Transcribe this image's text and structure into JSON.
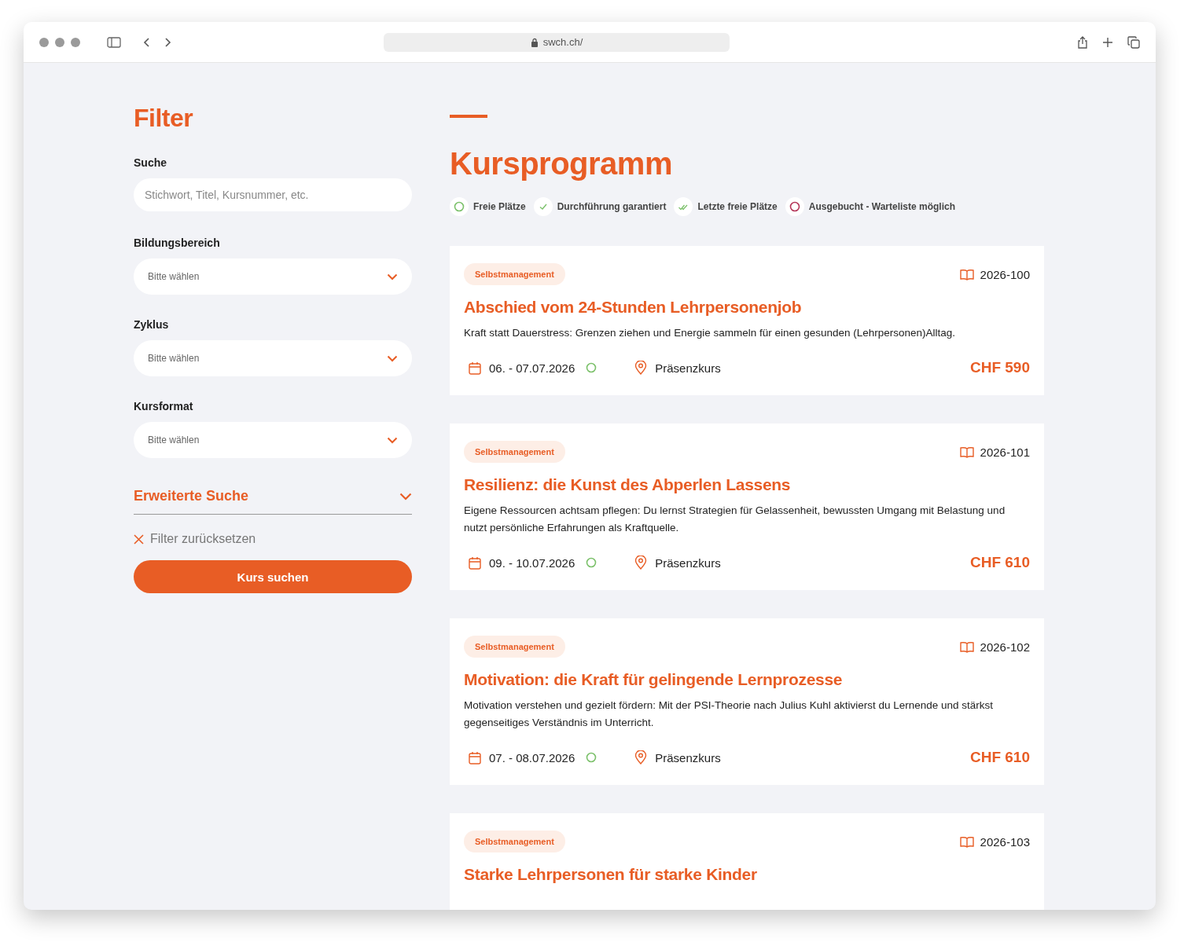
{
  "browser": {
    "url": "swch.ch/"
  },
  "filter": {
    "title": "Filter",
    "search": {
      "label": "Suche",
      "placeholder": "Stichwort, Titel, Kursnummer, etc."
    },
    "selects": [
      {
        "label": "Bildungsbereich",
        "placeholder": "Bitte wählen"
      },
      {
        "label": "Zyklus",
        "placeholder": "Bitte wählen"
      },
      {
        "label": "Kursformat",
        "placeholder": "Bitte wählen"
      }
    ],
    "advanced": {
      "label": "Erweiterte Suche",
      "expanded": false
    },
    "reset": "Filter zurücksetzen",
    "submit": "Kurs suchen"
  },
  "main": {
    "title": "Kursprogramm",
    "legend": [
      {
        "kind": "free",
        "label": "Freie Plätze"
      },
      {
        "kind": "guaranteed",
        "label": "Durchführung garantiert"
      },
      {
        "kind": "last",
        "label": "Letzte freie Plätze"
      },
      {
        "kind": "booked",
        "label": "Ausgebucht - Warteliste möglich"
      }
    ],
    "courses": [
      {
        "tag": "Selbstmanagement",
        "number": "2026-100",
        "title": "Abschied vom 24-Stunden Lehrpersonenjob",
        "description": "Kraft statt Dauerstress: Grenzen ziehen und Energie sammeln für einen gesunden (Lehrpersonen)Alltag.",
        "date": "06. - 07.07.2026",
        "kind": "free",
        "format": "Präsenzkurs",
        "price": "CHF 590"
      },
      {
        "tag": "Selbstmanagement",
        "number": "2026-101",
        "title": "Resilienz: die Kunst des Abperlen Lassens",
        "description": "Eigene Ressourcen achtsam pflegen: Du lernst Strategien für Gelassenheit, bewussten Umgang mit Belastung und nutzt persönliche Erfahrungen als Kraftquelle.",
        "date": "09. - 10.07.2026",
        "kind": "free",
        "format": "Präsenzkurs",
        "price": "CHF 610"
      },
      {
        "tag": "Selbstmanagement",
        "number": "2026-102",
        "title": "Motivation: die Kraft für gelingende Lernprozesse",
        "description": "Motivation verstehen und gezielt fördern: Mit der PSI-Theorie nach Julius Kuhl aktivierst du Lernende und stärkst gegenseitiges Verständnis im Unterricht.",
        "date": "07. - 08.07.2026",
        "kind": "free",
        "format": "Präsenzkurs",
        "price": "CHF 610"
      },
      {
        "tag": "Selbstmanagement",
        "number": "2026-103",
        "title": "Starke Lehrpersonen für starke Kinder"
      }
    ]
  }
}
